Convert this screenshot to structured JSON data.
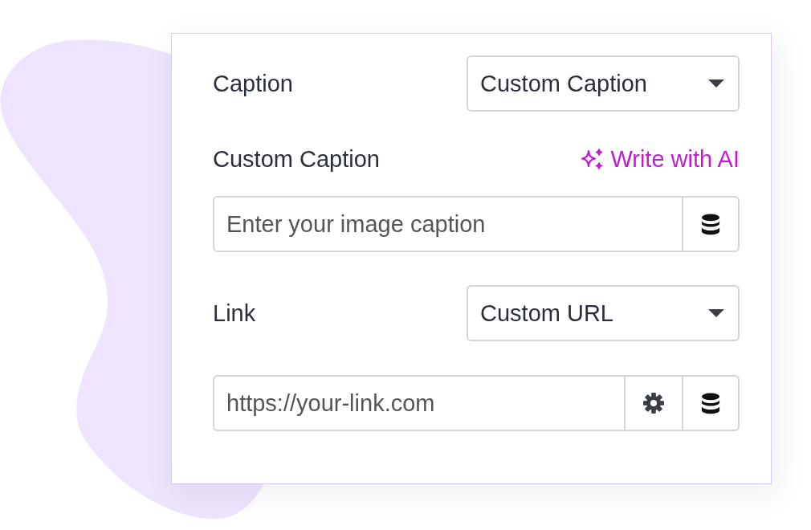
{
  "panel": {
    "rows": [
      {
        "kind": "select",
        "label": "Caption",
        "value": "Custom Caption"
      },
      {
        "kind": "label",
        "label": "Custom Caption",
        "action": "Write with AI"
      },
      {
        "kind": "input",
        "placeholder": "Enter your image caption",
        "addons": [
          {
            "kind": "database"
          }
        ]
      },
      {
        "kind": "select",
        "label": "Link",
        "value": "Custom URL"
      },
      {
        "kind": "input",
        "placeholder": "https://your-link.com",
        "addons": [
          {
            "kind": "settings"
          },
          {
            "kind": "database"
          }
        ]
      }
    ]
  }
}
